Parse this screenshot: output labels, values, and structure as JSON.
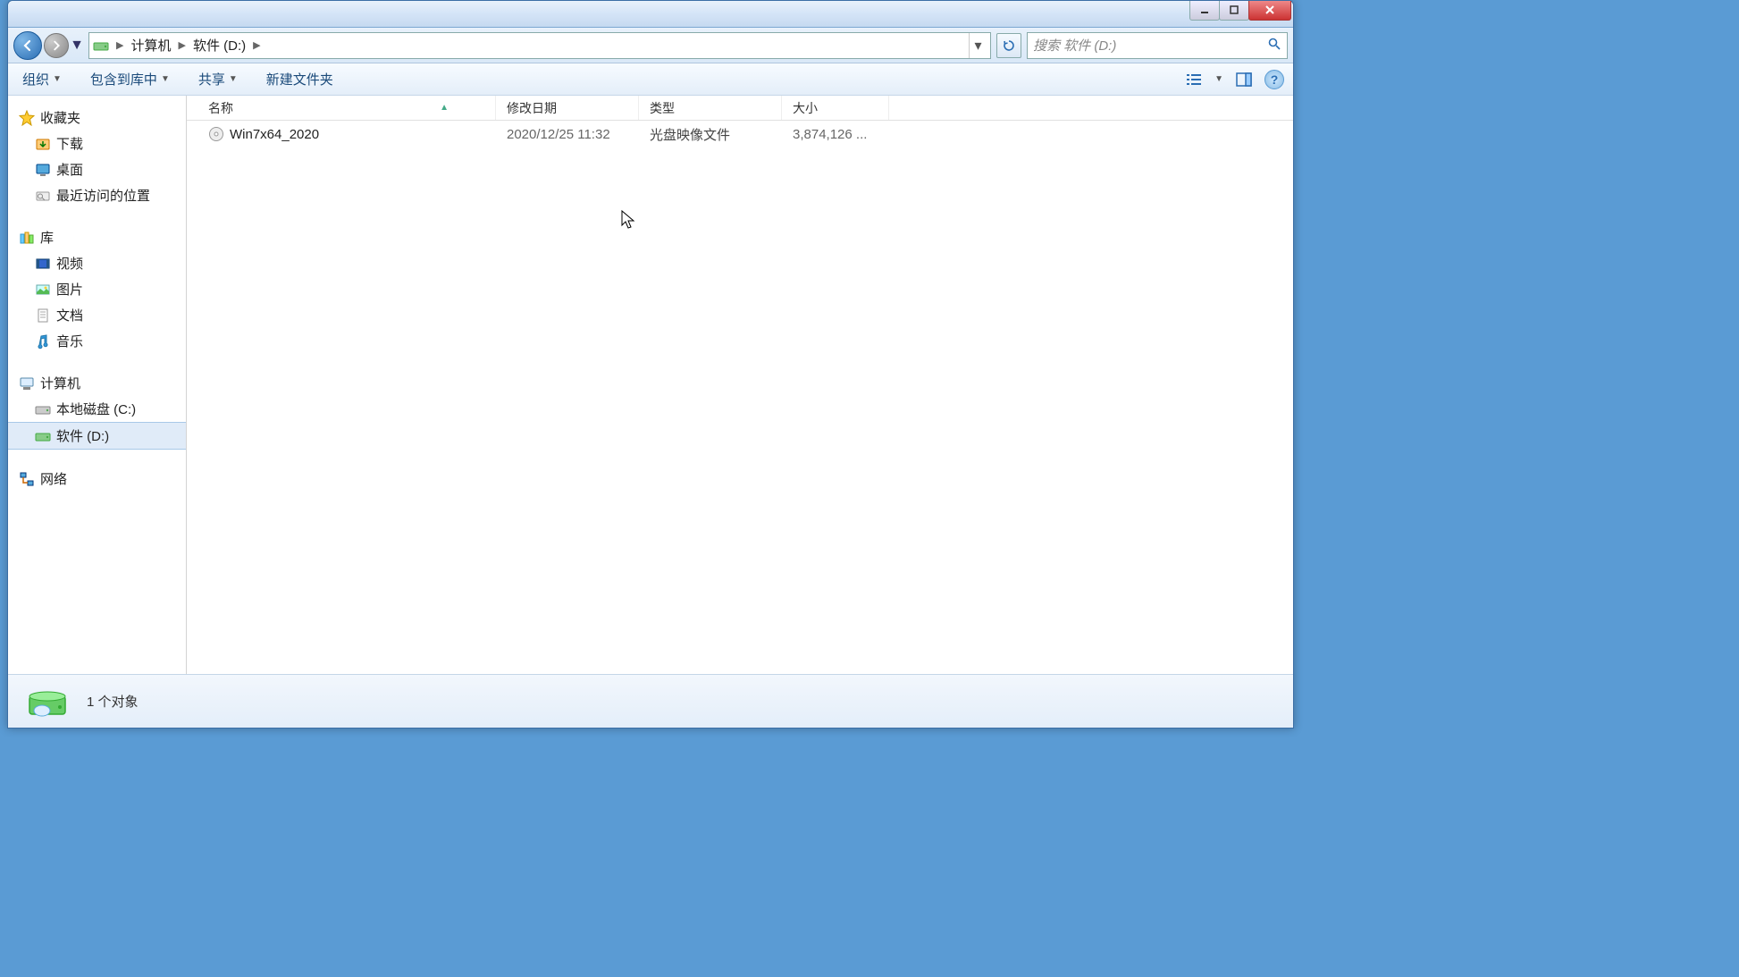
{
  "breadcrumb": {
    "computer": "计算机",
    "drive": "软件 (D:)"
  },
  "search": {
    "placeholder": "搜索 软件 (D:)"
  },
  "toolbar": {
    "organize": "组织",
    "include_in_library": "包含到库中",
    "share": "共享",
    "new_folder": "新建文件夹"
  },
  "columns": {
    "name": "名称",
    "date": "修改日期",
    "type": "类型",
    "size": "大小"
  },
  "files": [
    {
      "name": "Win7x64_2020",
      "date": "2020/12/25 11:32",
      "type": "光盘映像文件",
      "size": "3,874,126 ..."
    }
  ],
  "sidebar": {
    "favorites": {
      "title": "收藏夹",
      "downloads": "下载",
      "desktop": "桌面",
      "recent": "最近访问的位置"
    },
    "libraries": {
      "title": "库",
      "videos": "视频",
      "pictures": "图片",
      "documents": "文档",
      "music": "音乐"
    },
    "computer": {
      "title": "计算机",
      "local_c": "本地磁盘 (C:)",
      "software_d": "软件 (D:)"
    },
    "network": {
      "title": "网络"
    }
  },
  "status": {
    "text": "1 个对象"
  }
}
